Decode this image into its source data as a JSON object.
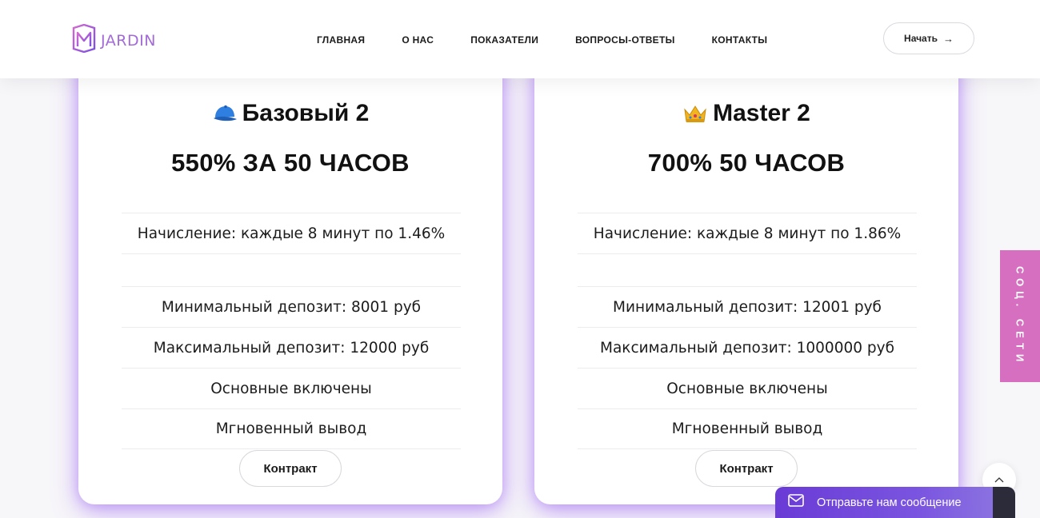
{
  "header": {
    "brand": "JARDIN",
    "nav": [
      "ГЛАВНАЯ",
      "О НАС",
      "ПОКАЗАТЕЛИ",
      "ВОПРОСЫ-ОТВЕТЫ",
      "КОНТАКТЫ"
    ],
    "start_label": "Начать",
    "start_icon": "arrow-right-icon"
  },
  "plans": [
    {
      "icon": "cap-icon",
      "title": "Базовый 2",
      "rate": "550% ЗА 50 ЧАСОВ",
      "accrual": "Начисление: каждые 8 минут по 1.46%",
      "min_deposit": "Минимальный депозит: 8001 руб",
      "max_deposit": "Максимальный депозит: 12000 руб",
      "main_included": "Основные включены",
      "withdrawal": "Мгновенный вывод",
      "button": "Контракт"
    },
    {
      "icon": "crown-icon",
      "title": "Master 2",
      "rate": "700% 50 ЧАСОВ",
      "accrual": "Начисление: каждые 8 минут по 1.86%",
      "min_deposit": "Минимальный депозит: 12001 руб",
      "max_deposit": "Максимальный депозит: 1000000 руб",
      "main_included": "Основные включены",
      "withdrawal": "Мгновенный вывод",
      "button": "Контракт"
    }
  ],
  "social_tab": "СОЦ. СЕТИ",
  "chat": {
    "label": "Отправьте нам сообщение",
    "icon": "mail-icon"
  },
  "colors": {
    "brand": "#a36bd8",
    "card_glow": "#9b5cf0",
    "social": "#d66fc0",
    "chat": "#6a3bd6"
  }
}
